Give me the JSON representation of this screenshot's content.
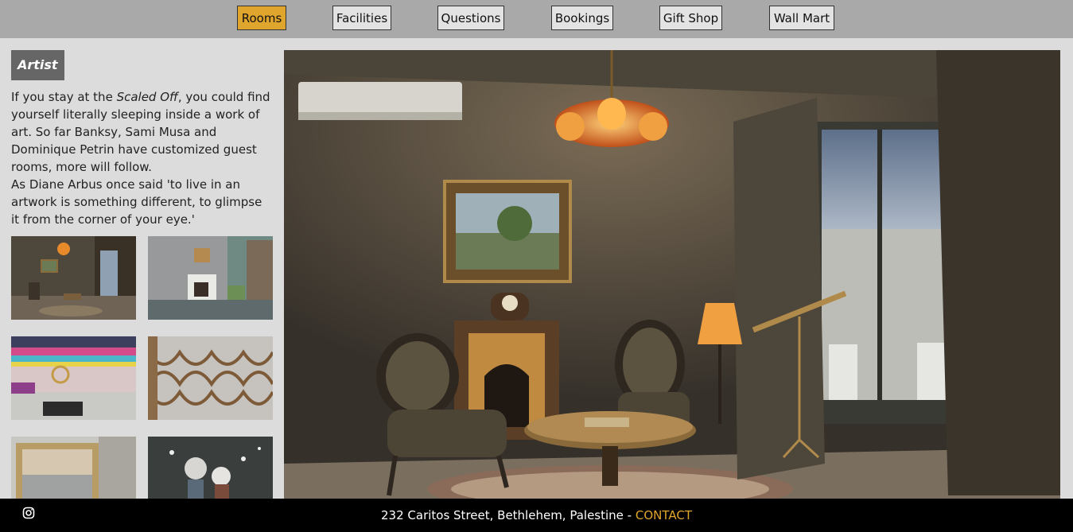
{
  "nav": {
    "items": [
      {
        "label": "Rooms",
        "active": true
      },
      {
        "label": "Facilities"
      },
      {
        "label": "Questions"
      },
      {
        "label": "Bookings"
      },
      {
        "label": "Gift Shop"
      },
      {
        "label": "Wall Mart"
      }
    ]
  },
  "sidebar": {
    "badge": "Artist",
    "intro": {
      "p1_before": "If you stay at the ",
      "p1_em": "Scaled Off",
      "p1_after": ", you could find yourself literally sleeping inside a work of art. So far Banksy, Sami Musa and Dominique Petrin have customized guest rooms, more will follow.",
      "p2": "As Diane Arbus once said 'to live in an artwork is something different, to glimpse it from the corner of your eye.'"
    }
  },
  "footer": {
    "address": "232 Caritos Street, Bethlehem, Palestine - ",
    "contact": "CONTACT"
  },
  "colors": {
    "accent": "#e0a52c",
    "nav_bg": "#a9a9a9",
    "page_bg": "#dcdcdc",
    "footer_bg": "#000000"
  },
  "icons": {
    "footer": "instagram-icon"
  }
}
